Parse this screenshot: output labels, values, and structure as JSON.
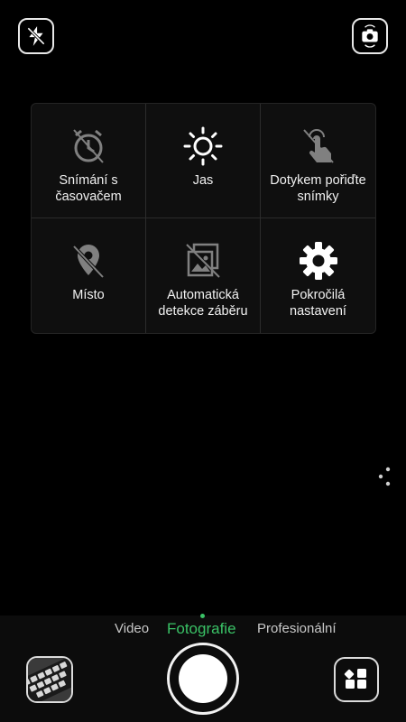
{
  "top_controls": {
    "flash_icon": "flash-off-icon",
    "switch_camera_icon": "switch-camera-icon"
  },
  "settings_panel": {
    "items": [
      {
        "label": "Snímání s časovačem",
        "icon": "timer-icon",
        "enabled": false
      },
      {
        "label": "Jas",
        "icon": "brightness-icon",
        "enabled": true
      },
      {
        "label": "Dotykem pořiďte snímky",
        "icon": "touch-capture-icon",
        "enabled": false
      },
      {
        "label": "Místo",
        "icon": "location-icon",
        "enabled": false
      },
      {
        "label": "Automatická detekce záběru",
        "icon": "scene-detection-icon",
        "enabled": false
      },
      {
        "label": "Pokročilá nastavení",
        "icon": "gear-icon",
        "enabled": true
      }
    ]
  },
  "modes": {
    "items": [
      "Video",
      "Fotografie",
      "Profesionální"
    ],
    "selected": "Fotografie"
  },
  "colors": {
    "accent": "#3ac266",
    "background": "#000000",
    "panel": "#0f0f0f"
  }
}
